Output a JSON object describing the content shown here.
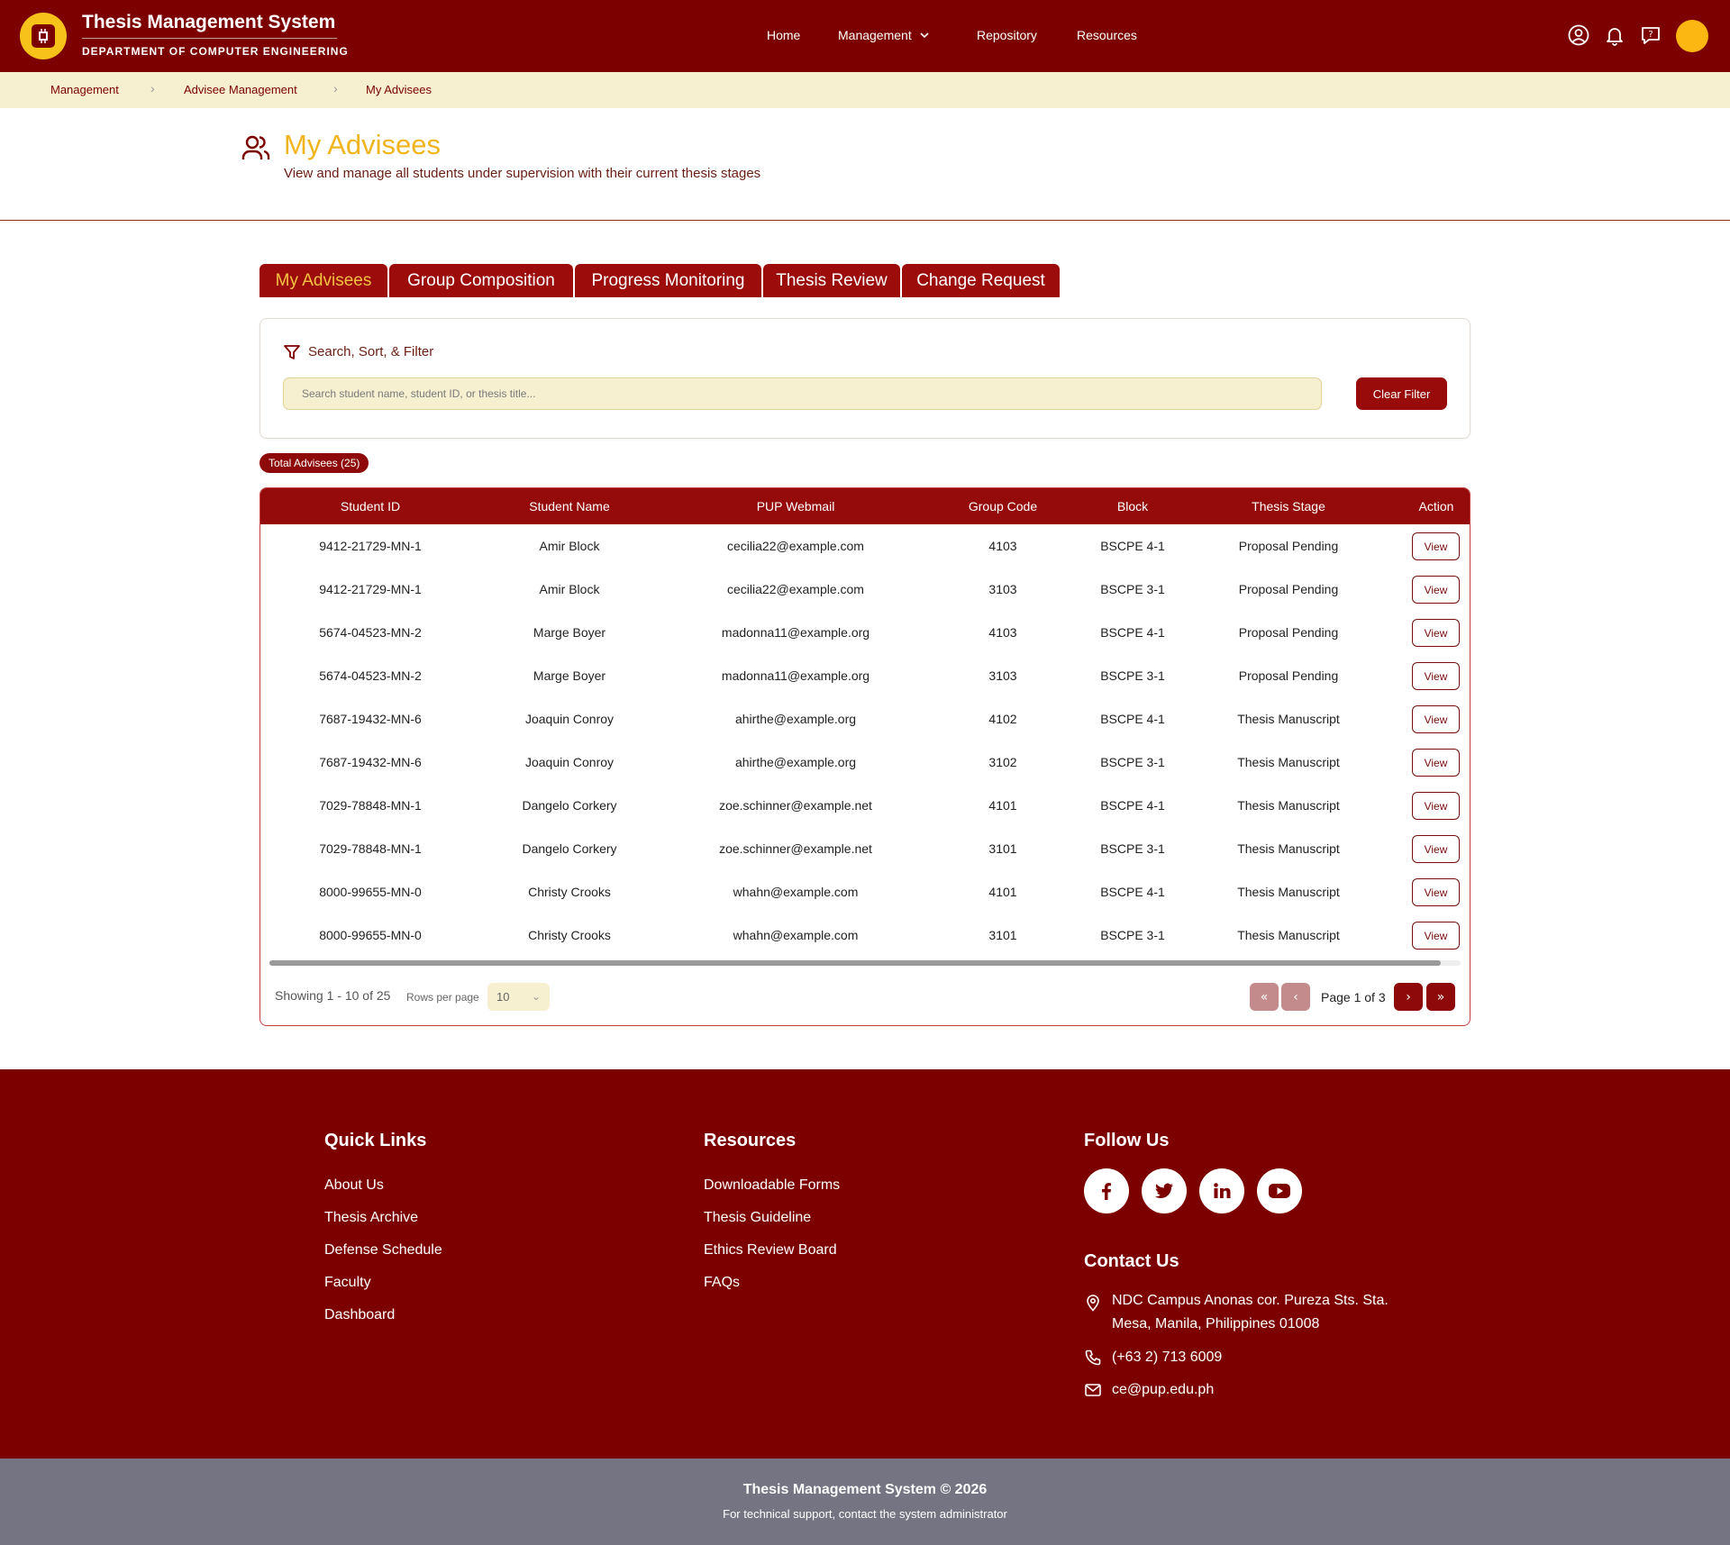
{
  "header": {
    "brand_title": "Thesis Management System",
    "brand_subtitle": "DEPARTMENT OF COMPUTER ENGINEERING",
    "nav": {
      "home": "Home",
      "management": "Management",
      "repository": "Repository",
      "resources": "Resources"
    }
  },
  "breadcrumb": [
    "Management",
    "Advisee Management",
    "My Advisees"
  ],
  "page": {
    "title": "My Advisees",
    "subtitle": "View and manage all students under supervision with their current thesis stages"
  },
  "tabs": [
    "My Advisees",
    "Group Composition",
    "Progress Monitoring",
    "Thesis Review",
    "Change Request"
  ],
  "filter": {
    "label": "Search, Sort, & Filter",
    "placeholder": "Search student name, student ID, or thesis title...",
    "clear_label": "Clear Filter"
  },
  "total_badge": "Total Advisees (25)",
  "table": {
    "columns": [
      "Student ID",
      "Student Name",
      "PUP Webmail",
      "Group Code",
      "Block",
      "Thesis Stage",
      "Action"
    ],
    "rows": [
      [
        "9412-21729-MN-1",
        "Amir Block",
        "cecilia22@example.com",
        "4103",
        "BSCPE 4-1",
        "Proposal Pending",
        "View"
      ],
      [
        "9412-21729-MN-1",
        "Amir Block",
        "cecilia22@example.com",
        "3103",
        "BSCPE 3-1",
        "Proposal Pending",
        "View"
      ],
      [
        "5674-04523-MN-2",
        "Marge Boyer",
        "madonna11@example.org",
        "4103",
        "BSCPE 4-1",
        "Proposal Pending",
        "View"
      ],
      [
        "5674-04523-MN-2",
        "Marge Boyer",
        "madonna11@example.org",
        "3103",
        "BSCPE 3-1",
        "Proposal Pending",
        "View"
      ],
      [
        "7687-19432-MN-6",
        "Joaquin Conroy",
        "ahirthe@example.org",
        "4102",
        "BSCPE 4-1",
        "Thesis Manuscript",
        "View"
      ],
      [
        "7687-19432-MN-6",
        "Joaquin Conroy",
        "ahirthe@example.org",
        "3102",
        "BSCPE 3-1",
        "Thesis Manuscript",
        "View"
      ],
      [
        "7029-78848-MN-1",
        "Dangelo Corkery",
        "zoe.schinner@example.net",
        "4101",
        "BSCPE 4-1",
        "Thesis Manuscript",
        "View"
      ],
      [
        "7029-78848-MN-1",
        "Dangelo Corkery",
        "zoe.schinner@example.net",
        "3101",
        "BSCPE 3-1",
        "Thesis Manuscript",
        "View"
      ],
      [
        "8000-99655-MN-0",
        "Christy Crooks",
        "whahn@example.com",
        "4101",
        "BSCPE 4-1",
        "Thesis Manuscript",
        "View"
      ],
      [
        "8000-99655-MN-0",
        "Christy Crooks",
        "whahn@example.com",
        "3101",
        "BSCPE 3-1",
        "Thesis Manuscript",
        "View"
      ]
    ]
  },
  "pagination": {
    "showing": "Showing 1 - 10 of 25",
    "rows_per_page_label": "Rows per page",
    "rows_per_page": "10",
    "page_info": "Page 1 of 3",
    "first": "«",
    "prev": "‹",
    "next": "›",
    "last": "»"
  },
  "footer": {
    "quick_links_title": "Quick Links",
    "quick_links": [
      "About Us",
      "Thesis Archive",
      "Defense Schedule",
      "Faculty",
      "Dashboard"
    ],
    "resources_title": "Resources",
    "resources": [
      "Downloadable Forms",
      "Thesis Guideline",
      "Ethics Review Board",
      "FAQs"
    ],
    "follow_title": "Follow Us",
    "social_icons": [
      "facebook-icon",
      "twitter-icon",
      "linkedin-icon",
      "youtube-icon"
    ],
    "contact_title": "Contact Us",
    "address_line1": "NDC Campus Anonas cor. Pureza Sts. Sta.",
    "address_line2": "Mesa, Manila, Philippines 01008",
    "phone": "(+63 2) 713 6009",
    "email": "ce@pup.edu.ph",
    "copyright": "Thesis Management System © 2026",
    "support": "For technical support, contact the system administrator"
  },
  "colors": {
    "maroon": "#7c0000",
    "gold": "#f0b41c",
    "cream": "#f6efd0",
    "footer_bottom": "#747483"
  }
}
